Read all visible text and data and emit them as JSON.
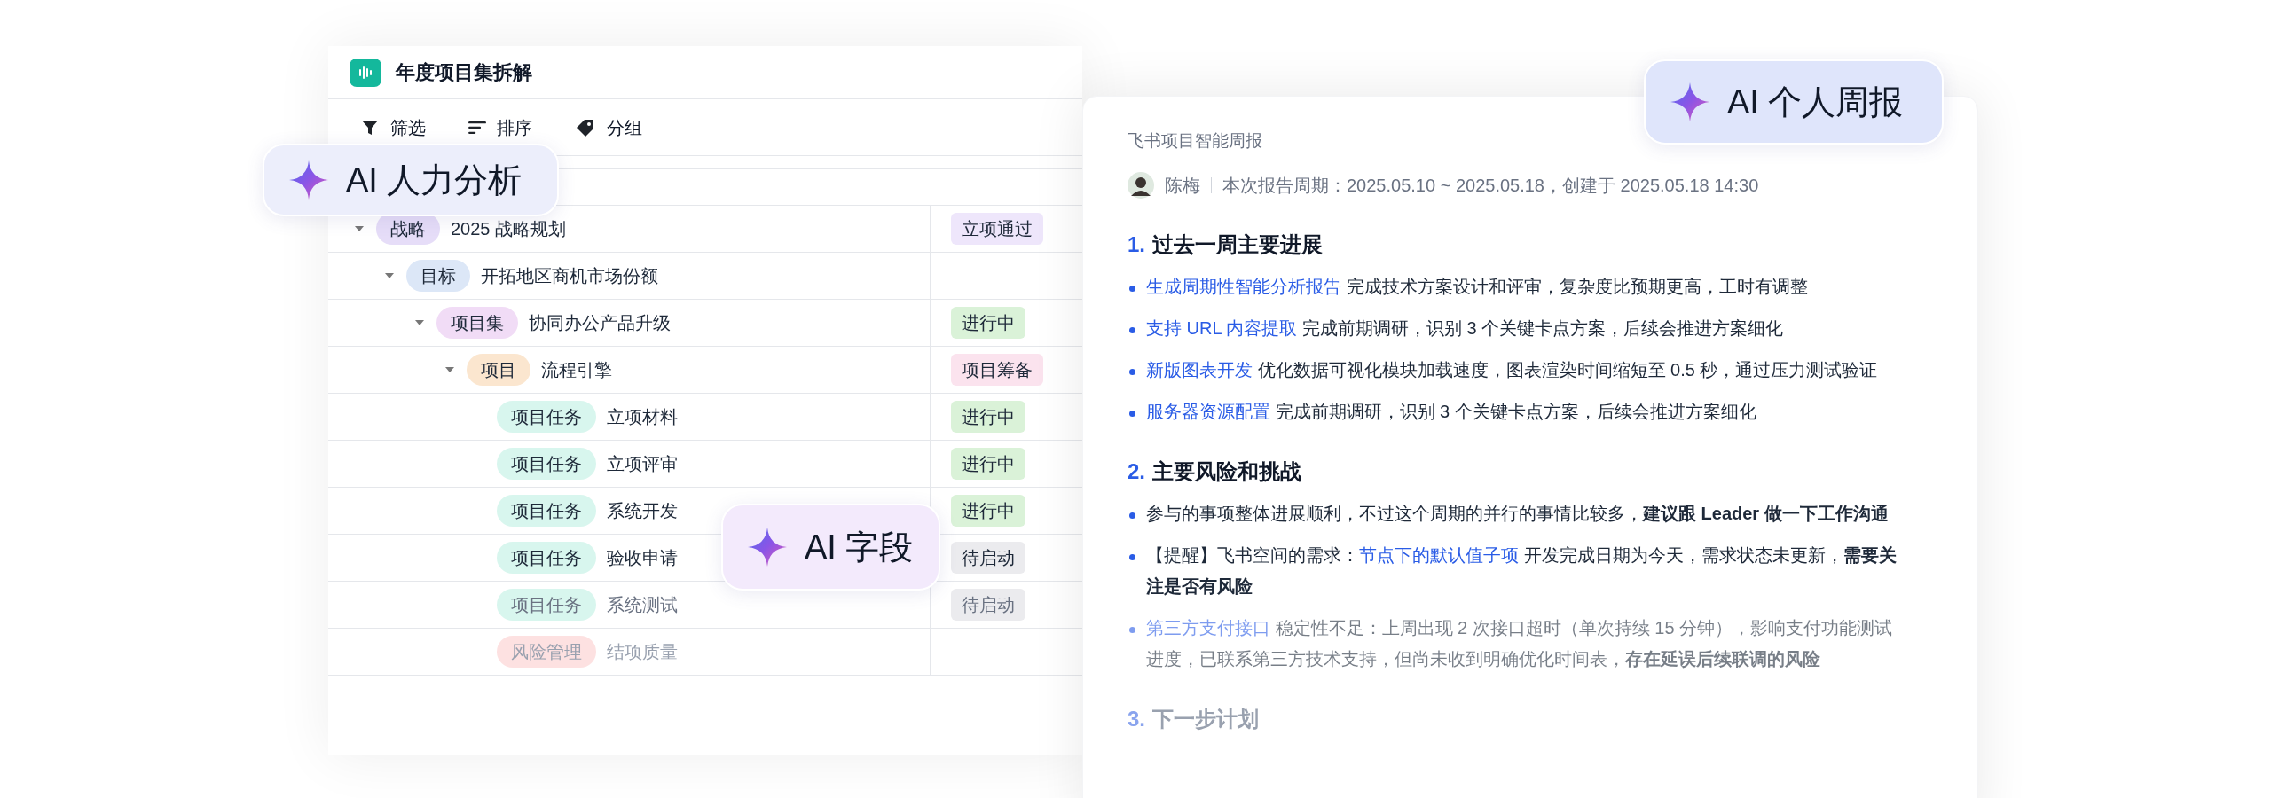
{
  "project_window": {
    "title": "年度项目集拆解",
    "toolbar": [
      {
        "kind": "filter",
        "label": "筛选"
      },
      {
        "kind": "sort",
        "label": "排序"
      },
      {
        "kind": "group",
        "label": "分组"
      }
    ],
    "tree": [
      {
        "tag": {
          "label": "战略",
          "color": "#e6ddf8"
        },
        "name": "2025 战略规划",
        "status": {
          "label": "立项通过",
          "color": "#eee6fb"
        },
        "expanded": true,
        "children": [
          {
            "tag": {
              "label": "目标",
              "color": "#dce7f7"
            },
            "name": "开拓地区商机市场份额",
            "expanded": true,
            "children": [
              {
                "tag": {
                  "label": "项目集",
                  "color": "#f1dcf6"
                },
                "name": "协同办公产品升级",
                "status": {
                  "label": "进行中",
                  "color": "#daf2d8"
                },
                "expanded": true,
                "children": [
                  {
                    "tag": {
                      "label": "项目",
                      "color": "#fbe6cf"
                    },
                    "name": "流程引擎",
                    "status": {
                      "label": "项目筹备",
                      "color": "#fbe3ee"
                    },
                    "expanded": true,
                    "children": [
                      {
                        "tag": {
                          "label": "项目任务",
                          "color": "#d8f6ee"
                        },
                        "name": "立项材料",
                        "status": {
                          "label": "进行中",
                          "color": "#daf2d8"
                        }
                      },
                      {
                        "tag": {
                          "label": "项目任务",
                          "color": "#d8f6ee"
                        },
                        "name": "立项评审",
                        "status": {
                          "label": "进行中",
                          "color": "#daf2d8"
                        }
                      },
                      {
                        "tag": {
                          "label": "项目任务",
                          "color": "#d8f6ee"
                        },
                        "name": "系统开发",
                        "status": {
                          "label": "进行中",
                          "color": "#daf2d8"
                        }
                      },
                      {
                        "tag": {
                          "label": "项目任务",
                          "color": "#d8f6ee"
                        },
                        "name": "验收申请",
                        "status": {
                          "label": "待启动",
                          "color": "#ebebee"
                        }
                      },
                      {
                        "tag": {
                          "label": "项目任务",
                          "color": "#d8f6ee"
                        },
                        "name": "系统测试",
                        "status": {
                          "label": "待启动",
                          "color": "#ebebee"
                        }
                      },
                      {
                        "tag": {
                          "label": "风险管理",
                          "color": "#fde1e1"
                        },
                        "name": "结项质量"
                      }
                    ]
                  }
                ]
              }
            ]
          }
        ]
      }
    ]
  },
  "report": {
    "title": "飞书项目智能周报",
    "author": "陈梅",
    "meta": "本次报告周期：2025.05.10 ~ 2025.05.18，创建于 2025.05.18 14:30",
    "sections": [
      {
        "number": "1.",
        "heading": "过去一周主要进展",
        "items": [
          [
            {
              "kind": "link",
              "text": "生成周期性智能分析报告"
            },
            {
              "kind": "text",
              "text": " 完成技术方案设计和评审，复杂度比预期更高，工时有调整"
            }
          ],
          [
            {
              "kind": "link",
              "text": "支持 URL 内容提取"
            },
            {
              "kind": "text",
              "text": " 完成前期调研，识别 3 个关键卡点方案，后续会推进方案细化"
            }
          ],
          [
            {
              "kind": "link",
              "text": "新版图表开发"
            },
            {
              "kind": "text",
              "text": " 优化数据可视化模块加载速度，图表渲染时间缩短至 0.5 秒，通过压力测试验证"
            }
          ],
          [
            {
              "kind": "link",
              "text": "服务器资源配置"
            },
            {
              "kind": "text",
              "text": " 完成前期调研，识别 3 个关键卡点方案，后续会推进方案细化"
            }
          ]
        ]
      },
      {
        "number": "2.",
        "heading": "主要风险和挑战",
        "items": [
          [
            {
              "kind": "text",
              "text": "参与的事项整体进展顺利，不过这个周期的并行的事情比较多，**建议跟 Leader 做一下工作沟通**"
            }
          ],
          [
            {
              "kind": "text",
              "text": "【提醒】飞书空间的需求："
            },
            {
              "kind": "link",
              "text": "节点下的默认值子项"
            },
            {
              "kind": "text",
              "text": " 开发完成日期为今天，需求状态未更新，**需要关注是否有风险**"
            }
          ],
          [
            {
              "kind": "link",
              "text": "第三方支付接口"
            },
            {
              "kind": "text",
              "text": " 稳定性不足：上周出现 2 次接口超时（单次持续 15 分钟），影响支付功能测试进度，已联系第三方技术支持，但尚未收到明确优化时间表，**存在延误后续联调的风险**"
            }
          ]
        ]
      },
      {
        "number": "3.",
        "heading": "下一步计划"
      }
    ]
  },
  "badges": [
    {
      "label": "AI 人力分析",
      "color": "#eceefb"
    },
    {
      "label": "AI 字段",
      "color": "#f3eafc"
    },
    {
      "label": "AI 个人周报",
      "color": "#dfe5fb"
    }
  ]
}
